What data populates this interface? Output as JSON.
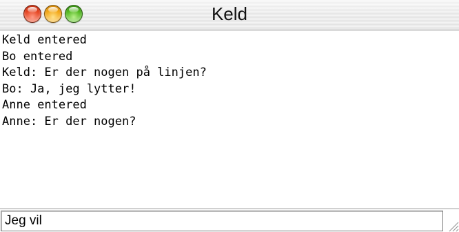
{
  "window": {
    "title": "Keld"
  },
  "transcript": {
    "lines": [
      "Keld entered",
      "Bo entered",
      "Keld: Er der nogen på linjen?",
      "Bo: Ja, jeg lytter!",
      "Anne entered",
      "Anne: Er der nogen?"
    ]
  },
  "input": {
    "value": "Jeg vil "
  },
  "icons": {
    "close": "close-icon",
    "minimize": "minimize-icon",
    "zoom": "zoom-icon",
    "resize": "resize-grip-icon"
  },
  "colors": {
    "close": "#e4401c",
    "minimize": "#f2a310",
    "zoom": "#4db51a"
  }
}
